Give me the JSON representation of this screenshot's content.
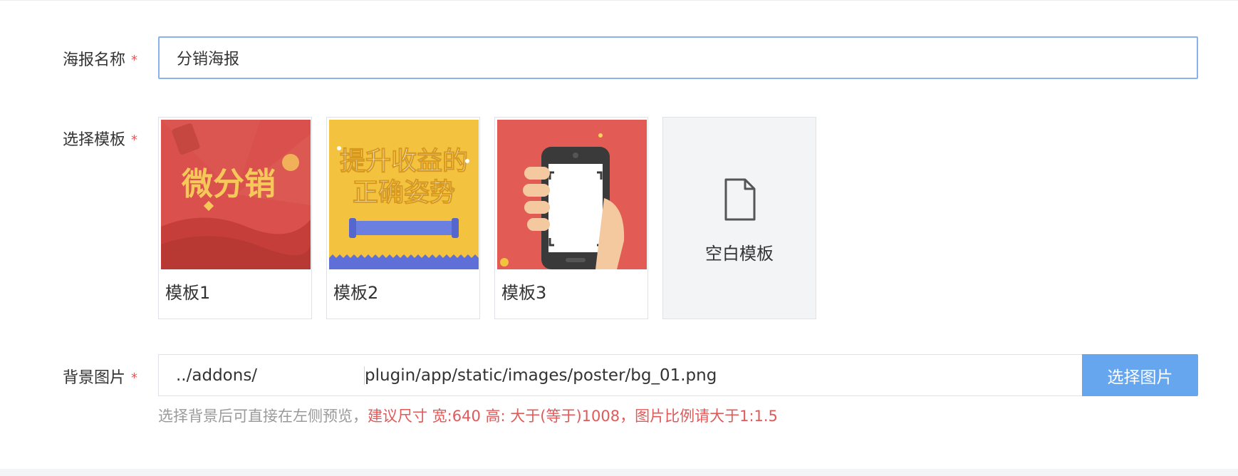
{
  "form": {
    "poster_name": {
      "label": "海报名称",
      "required_mark": "*",
      "value": "分销海报"
    },
    "template": {
      "label": "选择模板",
      "required_mark": "*",
      "cards": [
        {
          "name": "模板1",
          "thumb_text": "微分销"
        },
        {
          "name": "模板2",
          "thumb_text_line1": "提升收益的",
          "thumb_text_line2": "正确姿势"
        },
        {
          "name": "模板3"
        }
      ],
      "blank": {
        "label": "空白模板",
        "icon": "file-icon"
      }
    },
    "background": {
      "label": "背景图片",
      "required_mark": "*",
      "path_prefix": "../addons/",
      "path_suffix": "plugin/app/static/images/poster/bg_01.png",
      "button_label": "选择图片",
      "hint_gray": "选择背景后可直接在左侧预览，",
      "hint_red": "建议尺寸 宽:640 高: 大于(等于)1008，图片比例请大于1:1.5"
    }
  },
  "colors": {
    "accent": "#66a6ef",
    "required": "#e25a5a",
    "input_focus_border": "#8ab2ec"
  }
}
